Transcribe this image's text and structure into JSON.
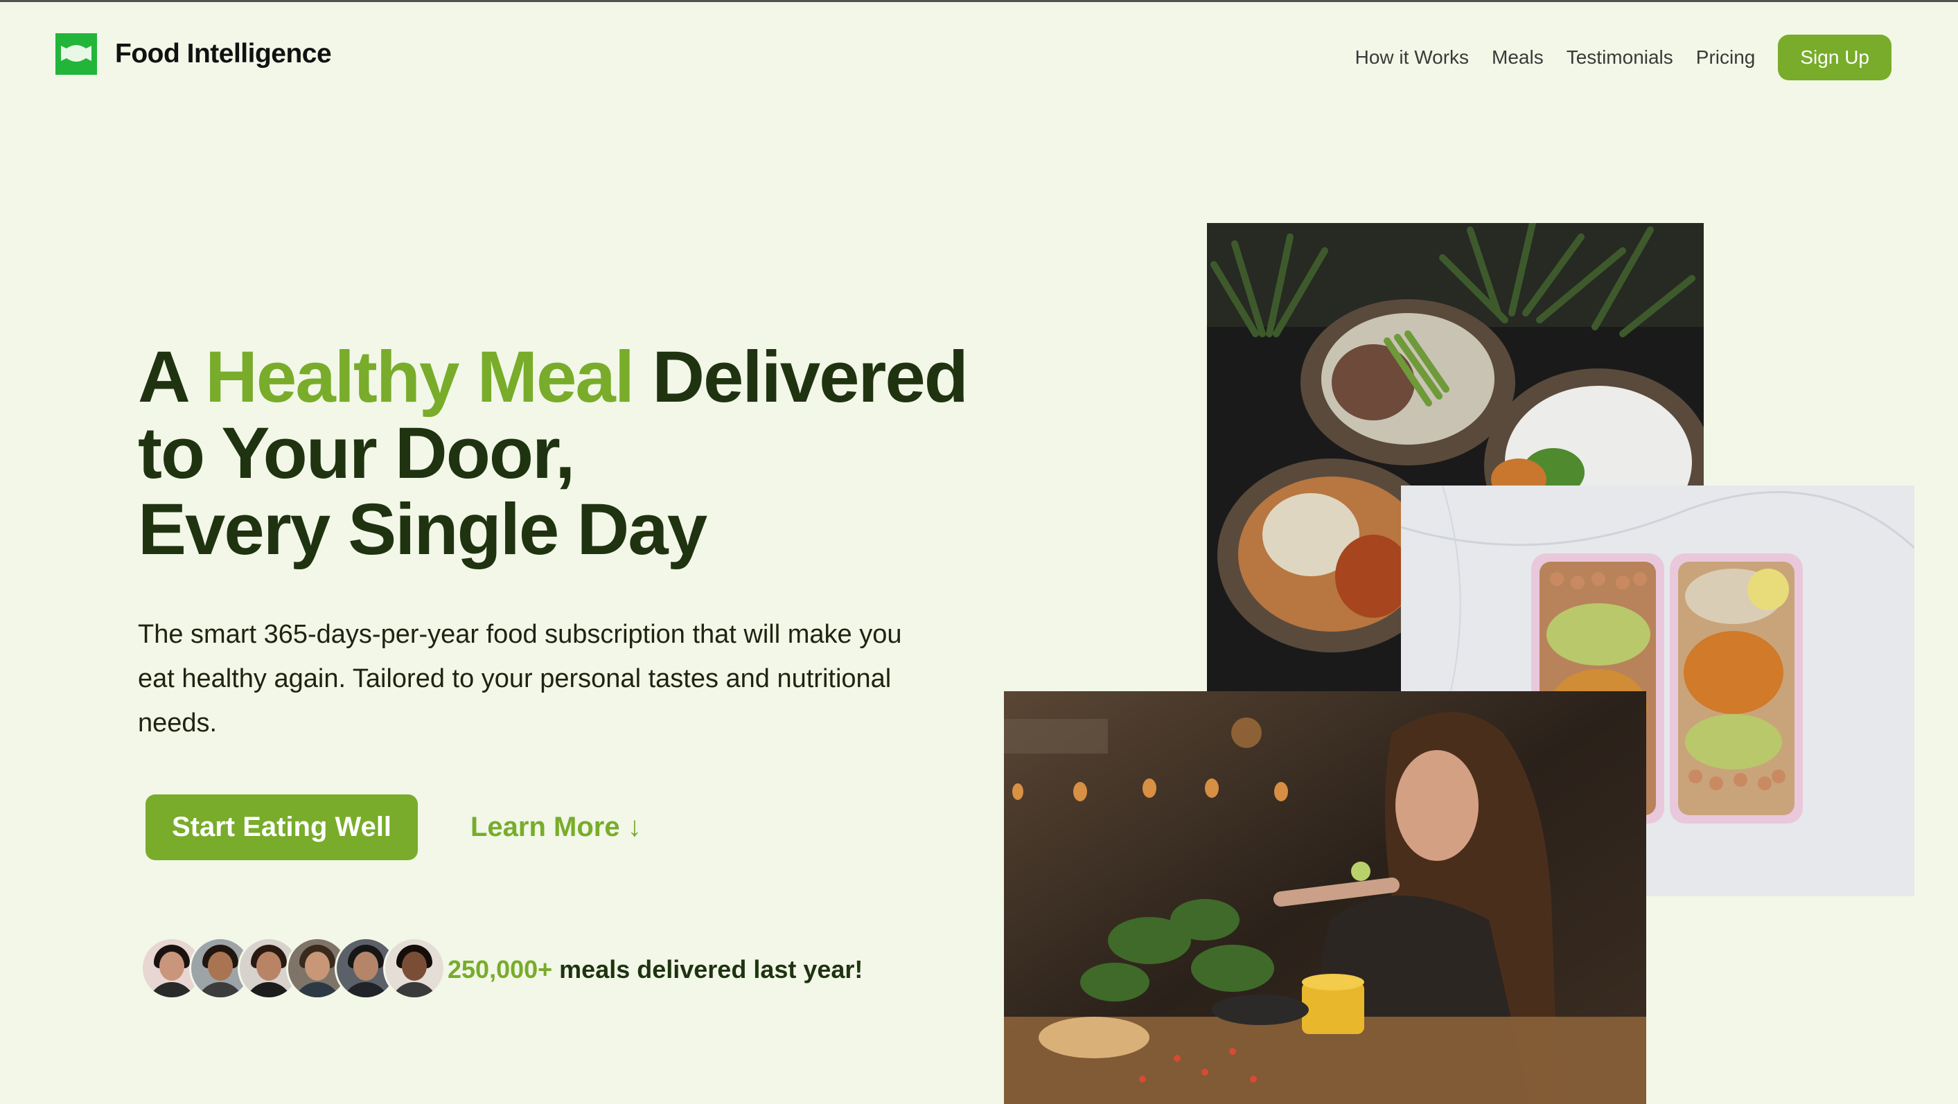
{
  "brand": {
    "name": "Food Intelligence",
    "logo_icon": "plate-logo-icon",
    "accent_color": "#78ac2a",
    "logo_color": "#22b53a"
  },
  "nav": {
    "items": [
      "How it Works",
      "Meals",
      "Testimonials",
      "Pricing"
    ],
    "signup_label": "Sign Up"
  },
  "hero": {
    "title_before": "A ",
    "title_accent": "Healthy Meal",
    "title_after": " Delivered",
    "title_line2": "to Your Door,",
    "title_line3": "Every Single Day",
    "description": "The smart 365-days-per-year food subscription that will make you eat healthy again. Tailored to your personal tastes and nutritional needs.",
    "primary_cta": "Start Eating Well",
    "secondary_cta": "Learn More ↓",
    "social_proof_count": "250,000+",
    "social_proof_text": " meals delivered last year!"
  },
  "images": {
    "bowls": "food-bowls-photo",
    "boxes": "meal-prep-boxes-photo",
    "woman": "woman-eating-photo"
  },
  "avatars": [
    "customer-avatar-1",
    "customer-avatar-2",
    "customer-avatar-3",
    "customer-avatar-4",
    "customer-avatar-5",
    "customer-avatar-6"
  ]
}
